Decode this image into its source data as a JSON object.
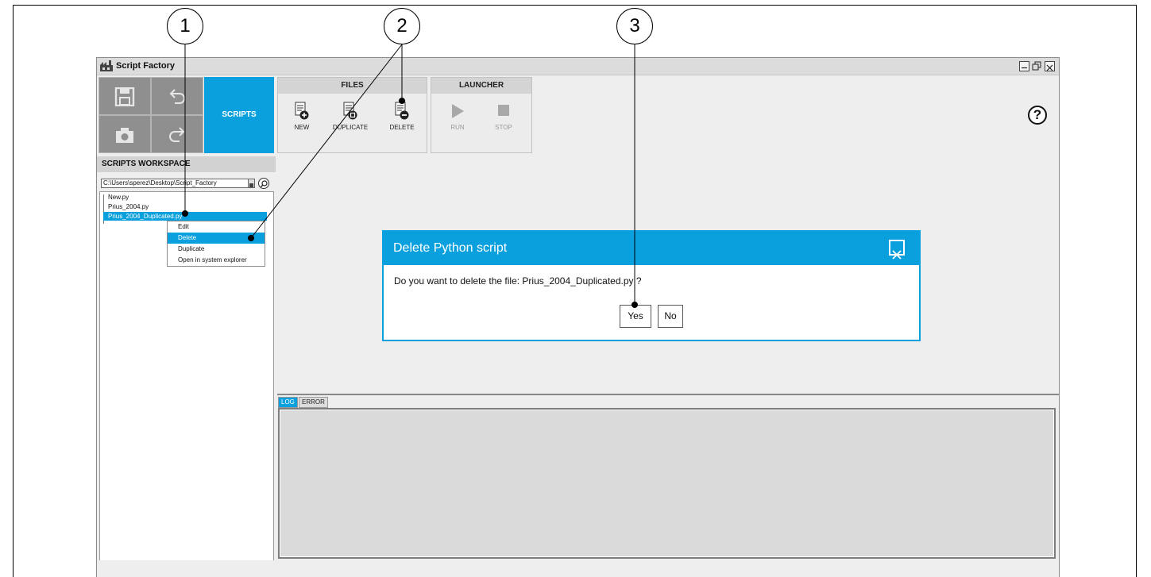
{
  "callouts": [
    "1",
    "2",
    "3"
  ],
  "window": {
    "title": "Script Factory",
    "controls": [
      "minimize-icon",
      "restore-icon",
      "close-icon"
    ]
  },
  "toolbar": {
    "tools": [
      "save-icon",
      "undo-icon",
      "camera-icon",
      "redo-icon"
    ],
    "scripts_label": "SCRIPTS"
  },
  "files_group": {
    "title": "FILES",
    "buttons": [
      {
        "label": "NEW",
        "icon": "new-script-icon"
      },
      {
        "label": "DUPLICATE",
        "icon": "duplicate-script-icon"
      },
      {
        "label": "DELETE",
        "icon": "delete-script-icon"
      }
    ]
  },
  "launcher_group": {
    "title": "LAUNCHER",
    "buttons": [
      {
        "label": "RUN",
        "icon": "play-icon"
      },
      {
        "label": "STOP",
        "icon": "stop-icon"
      }
    ]
  },
  "help": {
    "symbol": "?"
  },
  "workspace": {
    "title": "SCRIPTS WORKSPACE",
    "path": "C:\\Users\\sperez\\Desktop\\Script_Factory",
    "files": [
      "New.py",
      "Prius_2004.py",
      "Prius_2004_Duplicated.py"
    ],
    "selected_file": "Prius_2004_Duplicated.py"
  },
  "context_menu": {
    "items": [
      "Edit",
      "Delete",
      "Duplicate",
      "Open in system explorer"
    ],
    "selected": "Delete"
  },
  "console": {
    "tabs": [
      "LOG",
      "ERROR"
    ],
    "active_tab": "LOG"
  },
  "dialog": {
    "title": "Delete Python script",
    "message": "Do you want to delete the file: Prius_2004_Duplicated.py ?",
    "yes_label": "Yes",
    "no_label": "No"
  },
  "colors": {
    "accent": "#0aa0dd",
    "tool_gray": "#8f8f8f",
    "panel_gray": "#eeeeee"
  }
}
